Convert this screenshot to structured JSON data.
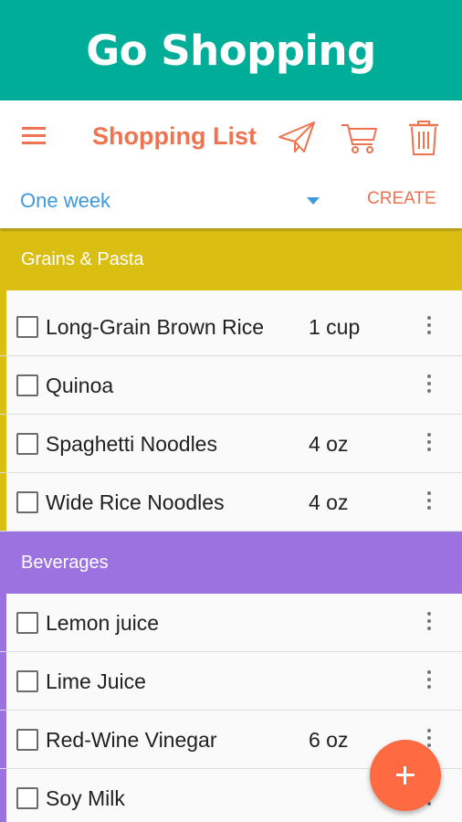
{
  "banner": {
    "title": "Go Shopping"
  },
  "toolbar": {
    "title": "Shopping List",
    "icons": [
      "menu-icon",
      "send-icon",
      "cart-icon",
      "trash-icon"
    ],
    "period": "One week",
    "create_label": "CREATE"
  },
  "colors": {
    "banner": "#00ad98",
    "accent_orange": "#ee7350",
    "link_blue": "#3d9ade",
    "grains": "#dbbe12",
    "beverages": "#9b72e0",
    "fab": "#fe6a42"
  },
  "sections": [
    {
      "title": "Grains & Pasta",
      "color": "#dbbe12",
      "items": [
        {
          "name": "Long-Grain Brown Rice",
          "qty": "1 cup"
        },
        {
          "name": "Quinoa",
          "qty": ""
        },
        {
          "name": "Spaghetti Noodles",
          "qty": "4 oz"
        },
        {
          "name": "Wide Rice Noodles",
          "qty": "4 oz"
        }
      ]
    },
    {
      "title": "Beverages",
      "color": "#9b72e0",
      "items": [
        {
          "name": "Lemon juice",
          "qty": ""
        },
        {
          "name": "Lime Juice",
          "qty": ""
        },
        {
          "name": "Red-Wine Vinegar",
          "qty": "6 oz"
        },
        {
          "name": "Soy Milk",
          "qty": ""
        }
      ]
    }
  ],
  "fab": {
    "icon": "plus-icon"
  }
}
